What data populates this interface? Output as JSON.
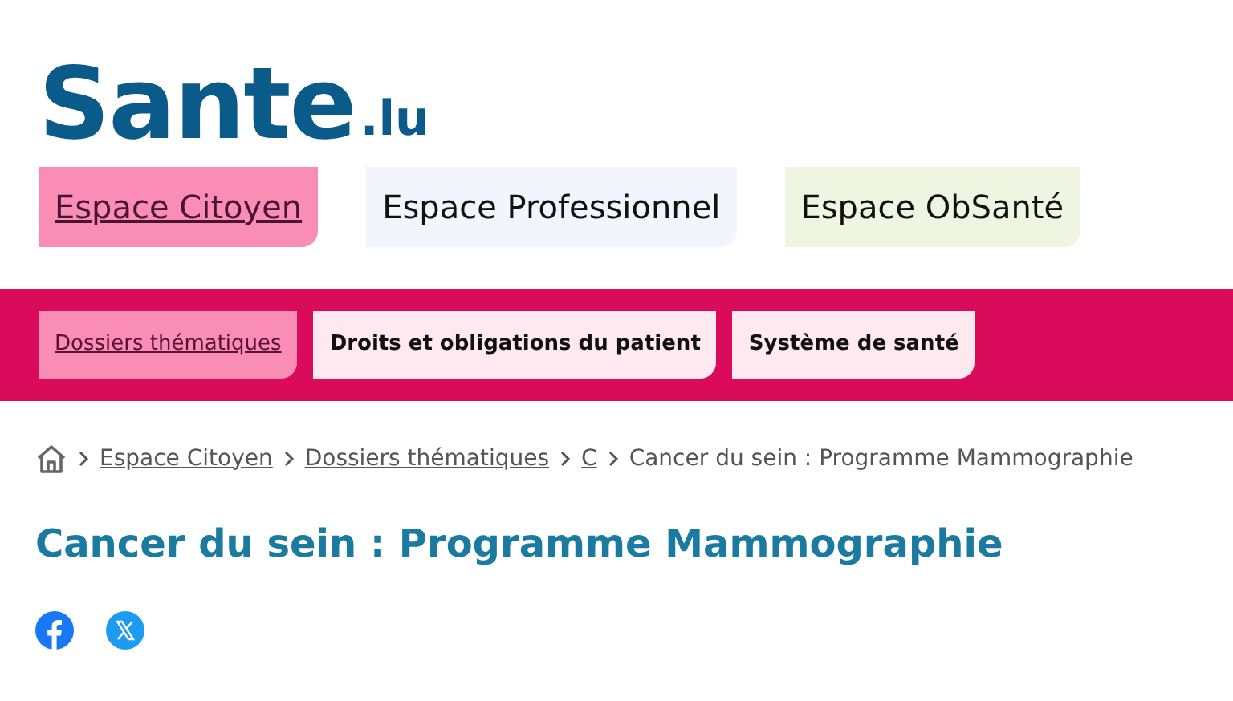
{
  "logo": {
    "main": "Sante",
    "suffix": ".lu"
  },
  "spaces": [
    {
      "label": "Espace Citoyen",
      "selected": true,
      "color": "#f98db5"
    },
    {
      "label": "Espace Professionnel",
      "selected": false,
      "color": "#f2f6fc"
    },
    {
      "label": "Espace ObSanté",
      "selected": false,
      "color": "#eef6e2"
    }
  ],
  "subnav": [
    {
      "label": "Dossiers thématiques",
      "selected": true
    },
    {
      "label": "Droits et obligations du patient",
      "selected": false
    },
    {
      "label": "Système de santé",
      "selected": false
    }
  ],
  "breadcrumb": [
    {
      "label": "Espace Citoyen",
      "kind": "link"
    },
    {
      "label": "Dossiers thématiques",
      "kind": "link"
    },
    {
      "label": "C",
      "kind": "link"
    },
    {
      "label": "Cancer du sein : Programme Mammographie",
      "kind": "current"
    }
  ],
  "title": "Cancer du sein : Programme Mammographie",
  "share": [
    {
      "kind": "facebook"
    },
    {
      "kind": "x"
    }
  ]
}
